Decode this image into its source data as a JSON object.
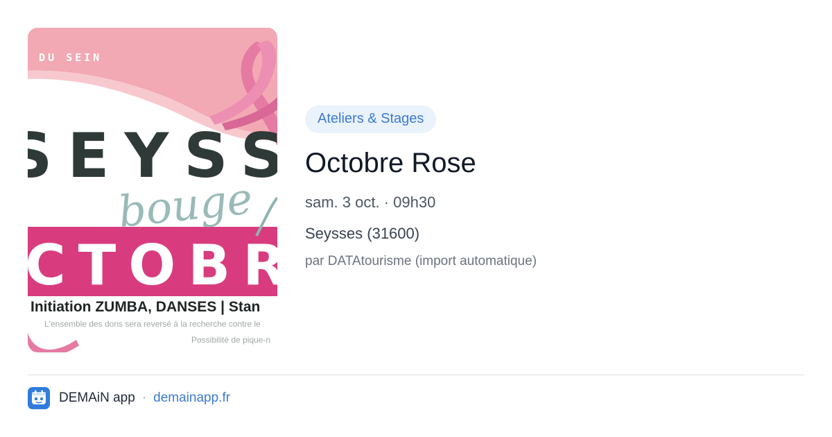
{
  "poster": {
    "top_text": "R DU SEIN",
    "town": "SEYSSES",
    "bouge": "bouge",
    "month": "CTOBRE R",
    "line1": "Initiation ZUMBA, DANSES | Stan",
    "line2": "L'ensemble des dons sera reversé à la recherche contre le",
    "line3": "Possibilité de pique-n",
    "colors": {
      "pink_light": "#f2a9b3",
      "pink_ribbon": "#e57aa3",
      "magenta_band": "#d93c7e"
    }
  },
  "event": {
    "category": "Ateliers & Stages",
    "title": "Octobre Rose",
    "datetime": "sam. 3 oct. · 09h30",
    "place": "Seysses (31600)",
    "source": "par DATAtourisme (import automatique)"
  },
  "footer": {
    "app_name": "DEMAiN app",
    "separator": "·",
    "domain": "demainapp.fr",
    "icon": "app-logo-icon"
  },
  "colors": {
    "accent": "#3d7bd0",
    "chip_bg": "#eaf2fc",
    "title": "#111827"
  }
}
